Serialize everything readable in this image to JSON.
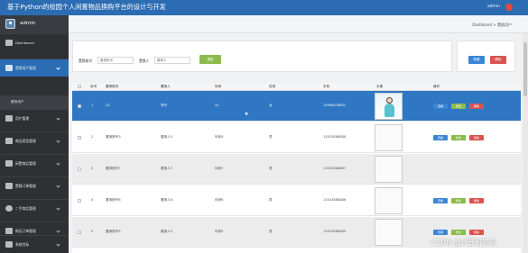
{
  "app": {
    "title": "基于Python的校园个人闲置物品换购平台的设计与开发",
    "user": "admin"
  },
  "sidebar": {
    "user_name": "admin",
    "items": [
      {
        "label": "Dashboard",
        "icon": "home-icon"
      },
      {
        "label": "置换用户管理",
        "icon": "grid-icon",
        "active": true
      },
      {
        "label": "用户管理",
        "icon": "users-icon"
      },
      {
        "label": "商品类型管理",
        "icon": "tag-icon"
      },
      {
        "label": "闲置商品管理",
        "icon": "box-icon"
      },
      {
        "label": "置换订单管理",
        "icon": "chart-icon"
      },
      {
        "label": "二手商品管理",
        "icon": "bulb-icon"
      },
      {
        "label": "购买订单管理",
        "icon": "bar-icon"
      },
      {
        "label": "系统目标",
        "icon": "settings-icon"
      }
    ],
    "sub_item": "置换用户"
  },
  "breadcrumb": "Dashboard > 置换用户",
  "search": {
    "field1_label": "置换账号",
    "field1_placeholder": "置换账号",
    "field2_label": "置换人",
    "field2_placeholder": "置换人",
    "search_label": "搜索"
  },
  "actions": {
    "add_label": "新增",
    "delete_label": "删除"
  },
  "table": {
    "headers": [
      "序号",
      "置换账号",
      "置换人",
      "年龄",
      "性别",
      "手机",
      "头像",
      "操作"
    ],
    "rows": [
      {
        "no": "1",
        "account": "22",
        "name": "李行",
        "age": "22",
        "gender": "女",
        "phone": "13958478851",
        "photo": true,
        "selected": true
      },
      {
        "no": "2",
        "account": "置换账号3",
        "name": "置换人3",
        "age": "年龄3",
        "gender": "男",
        "phone": "13023888888",
        "photo": false
      },
      {
        "no": "3",
        "account": "置换账号7",
        "name": "置换人7",
        "age": "年龄7",
        "gender": "男",
        "phone": "13023888887",
        "photo": false
      },
      {
        "no": "4",
        "account": "置换账号6",
        "name": "置换人6",
        "age": "年龄6",
        "gender": "男",
        "phone": "13023888886",
        "photo": false
      },
      {
        "no": "5",
        "account": "置换账号5",
        "name": "置换人5",
        "age": "年龄5",
        "gender": "男",
        "phone": "13023888885",
        "photo": false
      }
    ],
    "row_buttons": {
      "view": "查看",
      "edit": "修改",
      "delete": "删除"
    }
  },
  "watermark": "CSDN @计算机毕设",
  "colors": {
    "topbar": "#2b6cb3",
    "sidebar": "#2e3033",
    "active": "#2a6db5",
    "view": "#3b86d4",
    "edit": "#8bbb4c",
    "delete": "#d9534f"
  }
}
